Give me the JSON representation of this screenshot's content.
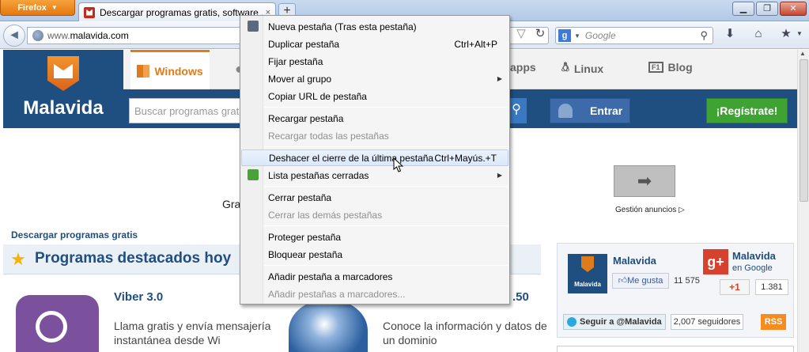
{
  "browser": {
    "menu_button": "Firefox",
    "tab_title": "Descargar programas gratis, software ...",
    "tab_close": "×",
    "new_tab": "+",
    "window_controls": [
      "▁",
      "❐",
      "✕"
    ],
    "url_prefix": "www.",
    "url_domain": "malavida.com",
    "search_engine_icon": "g",
    "search_placeholder": "Google"
  },
  "site": {
    "logo_text": "Malavida",
    "nav": {
      "windows": "Windows",
      "webapps": "apps",
      "linux": "Linux",
      "blog": "Blog"
    },
    "search_placeholder": "Buscar programas grat",
    "entrar": "Entrar",
    "register": "¡Regístrate!",
    "ads_label": "Gestión anuncios",
    "gra_text": "Gra",
    "breadcrumb": "Descargar programas gratis",
    "featured_title": "Programas destacados hoy",
    "viber_name": "Viber 3.0",
    "viber_desc": "Llama gratis y envía mensajería instantánea desde Wi",
    "version_partial": ".50",
    "whois_desc": "Conoce la información y datos de un dominio",
    "social": {
      "fb_name": "Malavida",
      "like": "Me gusta",
      "like_count": "11 575",
      "gplus_name": "Malavida",
      "gplus_sub": "en Google",
      "plusone": "+1",
      "plusone_count": "1.381",
      "twitter": "Seguir a @Malavida",
      "followers": "2,007 seguidores",
      "rss": "RSS",
      "logo_caption": "Malavida"
    }
  },
  "context_menu": {
    "items": [
      {
        "label": "Nueva pestaña  (Tras esta pestaña)",
        "shortcut": "",
        "disabled": false,
        "icon": "new-tab-icon"
      },
      {
        "label": "Duplicar pestaña",
        "shortcut": "Ctrl+Alt+P",
        "disabled": false
      },
      {
        "label": "Fijar pestaña",
        "shortcut": "",
        "disabled": false
      },
      {
        "label": "Mover al grupo",
        "shortcut": "",
        "disabled": false,
        "submenu": true
      },
      {
        "label": "Copiar URL de pestaña",
        "shortcut": "",
        "disabled": false
      },
      {
        "label": "Recargar pestaña",
        "shortcut": "",
        "disabled": false
      },
      {
        "label": "Recargar todas las pestañas",
        "shortcut": "",
        "disabled": true
      },
      {
        "label": "Deshacer el cierre de la última pestaña",
        "shortcut": "Ctrl+Mayús.+T",
        "disabled": false,
        "highlighted": true
      },
      {
        "label": "Lista pestañas cerradas",
        "shortcut": "",
        "disabled": false,
        "submenu": true,
        "icon": "closed-tabs-icon"
      },
      {
        "label": "Cerrar pestaña",
        "shortcut": "",
        "disabled": false
      },
      {
        "label": "Cerrar las demás pestañas",
        "shortcut": "",
        "disabled": true
      },
      {
        "label": "Proteger pestaña",
        "shortcut": "",
        "disabled": false
      },
      {
        "label": "Bloquear pestaña",
        "shortcut": "",
        "disabled": false
      },
      {
        "label": "Añadir pestaña a marcadores",
        "shortcut": "",
        "disabled": false
      },
      {
        "label": "Añadir pestañas a marcadores...",
        "shortcut": "",
        "disabled": true
      }
    ]
  },
  "colors": {
    "site_blue": "#1f4e80",
    "firefox_orange": "#e3780f",
    "register_green": "#3ea332"
  }
}
